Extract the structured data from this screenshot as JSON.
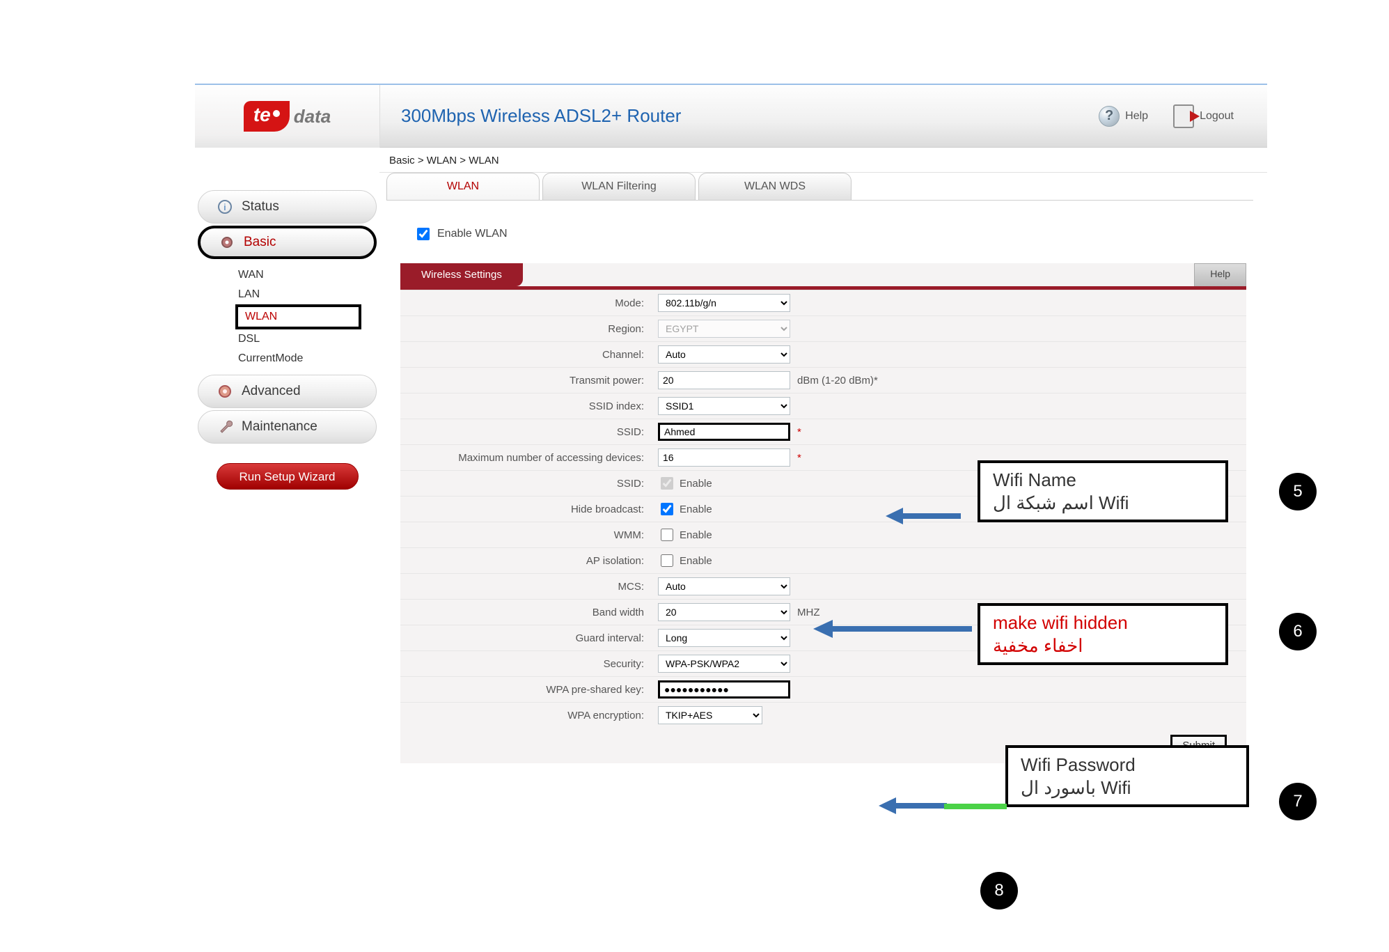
{
  "logo": {
    "brand_left": "te",
    "brand_right": "data"
  },
  "header": {
    "title": "300Mbps Wireless ADSL2+ Router",
    "help": "Help",
    "logout": "Logout"
  },
  "sidebar": {
    "status": "Status",
    "basic": "Basic",
    "basic_sub": {
      "wan": "WAN",
      "lan": "LAN",
      "wlan": "WLAN",
      "dsl": "DSL",
      "current_mode": "CurrentMode"
    },
    "advanced": "Advanced",
    "maintenance": "Maintenance",
    "wizard": "Run Setup Wizard"
  },
  "breadcrumb": "Basic > WLAN > WLAN",
  "tabs": {
    "wlan": "WLAN",
    "filtering": "WLAN Filtering",
    "wds": "WLAN WDS"
  },
  "form": {
    "enable_wlan": "Enable WLAN",
    "panel_title": "Wireless Settings",
    "panel_help": "Help",
    "mode_label": "Mode:",
    "mode_value": "802.11b/g/n",
    "region_label": "Region:",
    "region_value": "EGYPT",
    "channel_label": "Channel:",
    "channel_value": "Auto",
    "txpower_label": "Transmit power:",
    "txpower_value": "20",
    "txpower_suffix": "dBm (1-20 dBm)*",
    "ssid_index_label": "SSID index:",
    "ssid_index_value": "SSID1",
    "ssid_label": "SSID:",
    "ssid_value": "Ahmed",
    "maxdev_label": "Maximum number of accessing devices:",
    "maxdev_value": "16",
    "ssid_enable_label": "SSID:",
    "enable_text": "Enable",
    "hide_label": "Hide broadcast:",
    "wmm_label": "WMM:",
    "ap_iso_label": "AP isolation:",
    "mcs_label": "MCS:",
    "mcs_value": "Auto",
    "bw_label": "Band width",
    "bw_value": "20",
    "bw_suffix": "MHZ",
    "guard_label": "Guard interval:",
    "guard_value": "Long",
    "security_label": "Security:",
    "security_value": "WPA-PSK/WPA2",
    "psk_label": "WPA pre-shared key:",
    "psk_value": "●●●●●●●●●●●",
    "enc_label": "WPA encryption:",
    "enc_value": "TKIP+AES",
    "submit": "Submit"
  },
  "annotations": {
    "wifi_name_en": "Wifi Name",
    "wifi_name_ar": "اسم شبكة ال   Wifi",
    "hidden_en": "make wifi hidden",
    "hidden_ar": "اخفاء مخفية",
    "pwd_en": "Wifi Password",
    "pwd_ar": "باسورد ال   Wifi",
    "n5": "5",
    "n6": "6",
    "n7": "7",
    "n8": "8"
  }
}
